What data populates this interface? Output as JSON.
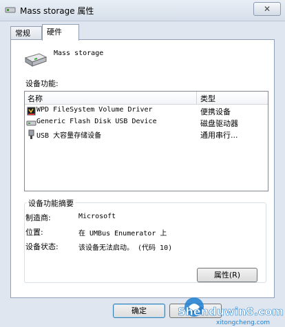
{
  "window": {
    "title": "Mass storage 属性",
    "close_glyph": "✕"
  },
  "tabs": [
    {
      "label": "常规"
    },
    {
      "label": "硬件"
    }
  ],
  "device": {
    "name": "Mass storage"
  },
  "functions": {
    "label": "设备功能:",
    "col_name": "名称",
    "col_type": "类型",
    "rows": [
      {
        "name": "WPD FileSystem Volume Driver",
        "type": "便携设备",
        "icon": "portable-device-icon"
      },
      {
        "name": "Generic Flash Disk USB Device",
        "type": "磁盘驱动器",
        "icon": "disk-drive-icon"
      },
      {
        "name": "USB 大容量存储设备",
        "type": "通用串行...",
        "icon": "usb-icon"
      }
    ]
  },
  "summary": {
    "title": "设备功能摘要",
    "manufacturer_label": "制造商:",
    "manufacturer_value": "Microsoft",
    "location_label": "位置:",
    "location_value": "在 UMBus Enumerator 上",
    "status_label": "设备状态:",
    "status_value": "该设备无法启动。 (代码 10)",
    "properties_button": "属性(R)"
  },
  "footer": {
    "ok": "确定",
    "cancel": "取消"
  },
  "watermark": {
    "main": "Shenduwin8.com",
    "sub": "xitongcheng.com"
  },
  "colors": {
    "window_bg": "#dfe6ef",
    "accent": "#3c7fb1",
    "watermark": "#1f7fd1"
  }
}
